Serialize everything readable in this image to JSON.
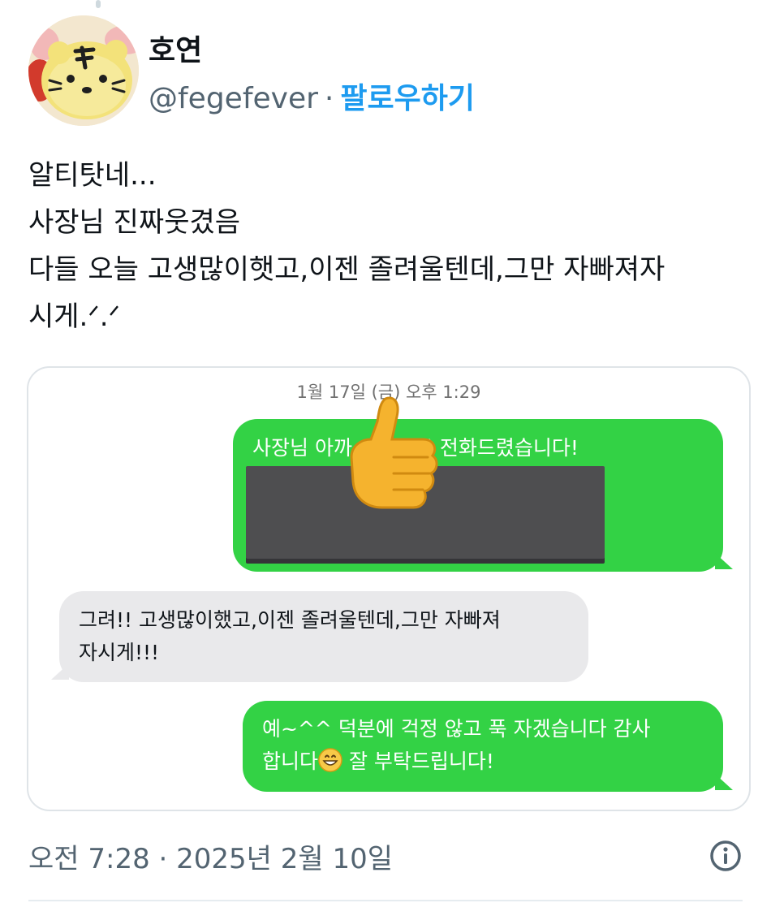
{
  "author": {
    "name": "호연",
    "handle": "@fegefever",
    "separator": "·",
    "follow_label": "팔로우하기",
    "avatar": "tiger-rice-ball-avatar"
  },
  "tweet": {
    "lines": [
      "알티탓네...",
      "사장님 진짜웃겼음",
      "다들 오늘 고생많이햇고,이젠 졸려울텐데,그만 자빠져자",
      "시게.ᐟ.ᐟ"
    ]
  },
  "screenshot": {
    "date": "1월 17일 (금) 오후 1:29",
    "messages": [
      {
        "side": "right",
        "text": "사장님 아까 ○○○ 이름으로 전화드렸습니다!",
        "visible_text": "사장님 아까        이름으로 전화드렸습니다!",
        "redacted": true
      },
      {
        "side": "left",
        "text": "그려!! 고생많이했고,이젠 졸려울텐데,그만 자빠져 자시게!!!",
        "line1": "그려!! 고생많이했고,이젠 졸려울텐데,그만 자빠져",
        "line2": "자시게!!!"
      },
      {
        "side": "right",
        "line1": "예~^^ 덕분에 걱정 않고 푹 자겠습니다 감사",
        "line2_a": "합니다",
        "line2_b": " 잘 부탁드립니다!"
      }
    ],
    "stickers": [
      "thumbs-up-emoji",
      "grinning-face-emoji"
    ]
  },
  "footer": {
    "timestamp": "오전 7:28 · 2025년 2월 10일",
    "info_icon": "info-icon"
  },
  "colors": {
    "follow_blue": "#1d9bf0",
    "imessage_green": "#33d245",
    "bubble_gray": "#e9e9eb"
  }
}
